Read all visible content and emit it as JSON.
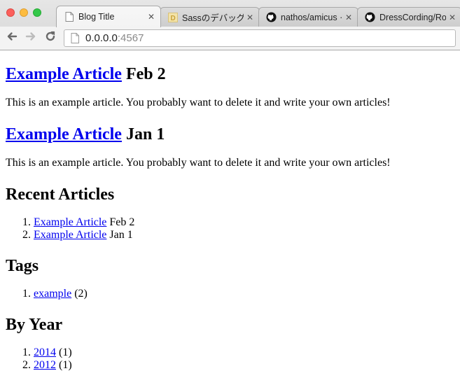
{
  "browser": {
    "tabs": [
      {
        "title": "Blog Title",
        "icon": "page-icon",
        "active": true
      },
      {
        "title": "Sassのデバッグに",
        "icon": "d-logo-icon",
        "active": false
      },
      {
        "title": "nathos/amicus · G",
        "icon": "github-icon",
        "active": false
      },
      {
        "title": "DressCording/Ro",
        "icon": "github-icon",
        "active": false
      }
    ],
    "tab_close_glyph": "✕",
    "url_host": "0.0.0.0",
    "url_port": ":4567"
  },
  "articles": [
    {
      "title": "Example Article",
      "date": "Feb 2",
      "body": "This is an example article. You probably want to delete it and write your own articles!"
    },
    {
      "title": "Example Article",
      "date": "Jan 1",
      "body": "This is an example article. You probably want to delete it and write your own articles!"
    }
  ],
  "recent": {
    "heading": "Recent Articles",
    "items": [
      {
        "title": "Example Article",
        "date": "Feb 2"
      },
      {
        "title": "Example Article",
        "date": "Jan 1"
      }
    ]
  },
  "tags": {
    "heading": "Tags",
    "items": [
      {
        "name": "example",
        "count": "(2)"
      }
    ]
  },
  "by_year": {
    "heading": "By Year",
    "items": [
      {
        "year": "2014",
        "count": "(1)"
      },
      {
        "year": "2012",
        "count": "(1)"
      }
    ]
  }
}
